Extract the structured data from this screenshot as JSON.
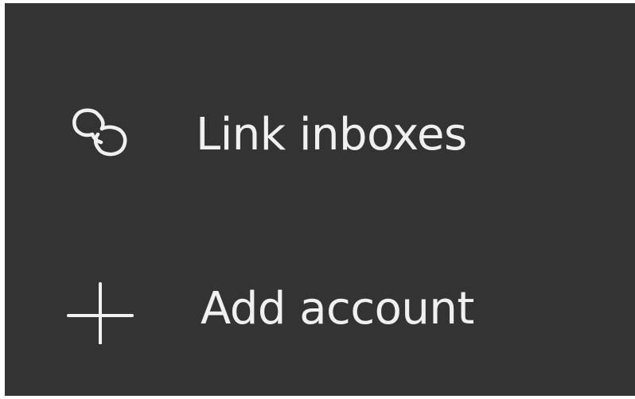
{
  "menu": {
    "items": [
      {
        "label": "Link inboxes",
        "icon": "link-icon"
      },
      {
        "label": "Add account",
        "icon": "plus-icon"
      }
    ]
  },
  "colors": {
    "panel_background": "#333333",
    "text": "#f0f0f0",
    "icon": "#f0f0f0"
  }
}
